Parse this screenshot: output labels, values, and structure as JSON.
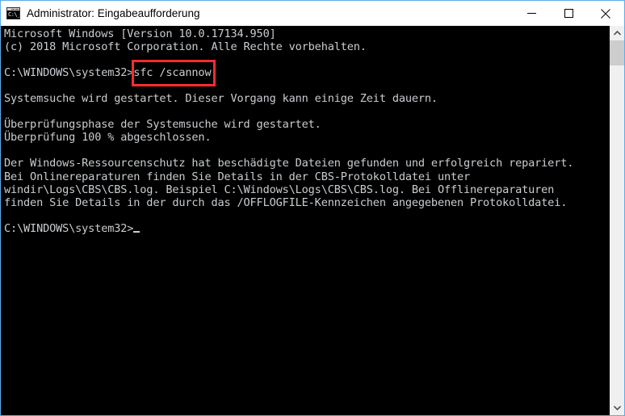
{
  "window": {
    "title": "Administrator: Eingabeaufforderung",
    "icon": "cmd-console-icon",
    "icon_glyph": "C:\\_",
    "border_color": "#5badec",
    "titlebar_bg": "#ffffff",
    "titlebar_fg": "#000000"
  },
  "window_controls": {
    "minimize": "minimize-icon",
    "maximize": "maximize-icon",
    "close": "close-icon"
  },
  "console": {
    "background": "#000000",
    "foreground": "#c9cdd1",
    "lines": [
      "Microsoft Windows [Version 10.0.17134.950]",
      "(c) 2018 Microsoft Corporation. Alle Rechte vorbehalten.",
      "",
      "C:\\WINDOWS\\system32>sfc /scannow",
      "",
      "Systemsuche wird gestartet. Dieser Vorgang kann einige Zeit dauern.",
      "",
      "Überprüfungsphase der Systemsuche wird gestartet.",
      "Überprüfung 100 % abgeschlossen.",
      "",
      "Der Windows-Ressourcenschutz hat beschädigte Dateien gefunden und erfolgreich repariert.",
      "Bei Onlinereparaturen finden Sie Details in der CBS-Protokolldatei unter",
      "windir\\Logs\\CBS\\CBS.log. Beispiel C:\\Windows\\Logs\\CBS\\CBS.log. Bei Offlinereparaturen",
      "finden Sie Details in der durch das /OFFLOGFILE-Kennzeichen angegebenen Protokolldatei.",
      "",
      "C:\\WINDOWS\\system32>"
    ],
    "prompt": "C:\\WINDOWS\\system32>",
    "command": "sfc /scannow",
    "progress_percent": "100 %"
  },
  "annotation": {
    "highlighted_text": "sfc /scannow",
    "color": "#fc2c2c",
    "shape": "rectangle"
  },
  "scrollbar": {
    "up_arrow": "chevron-up-icon",
    "down_arrow": "chevron-down-icon",
    "thumb": "scrollbar-thumb",
    "track_color": "#f0f0f0",
    "thumb_color": "#cdcdcd"
  }
}
